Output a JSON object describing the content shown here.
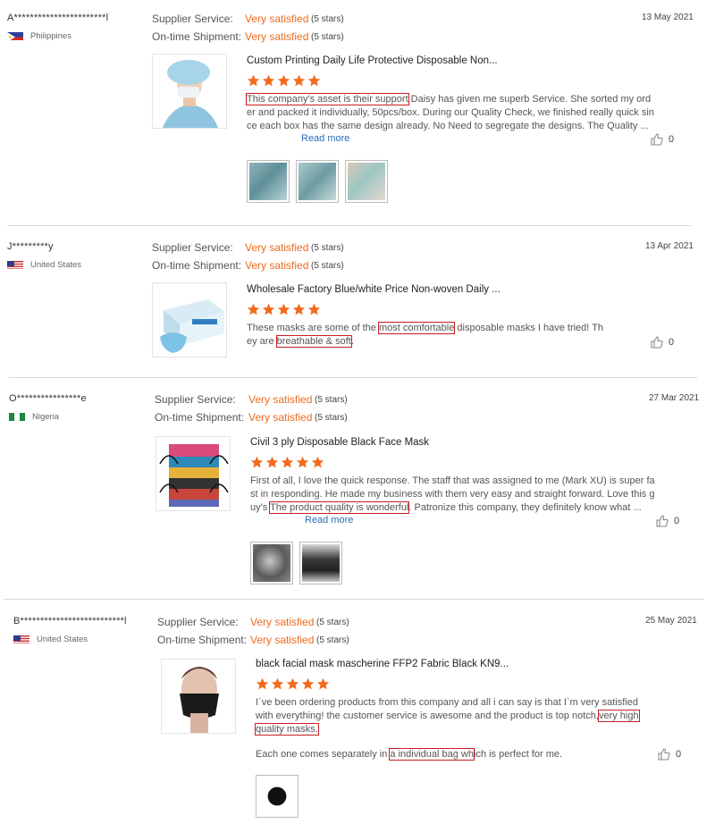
{
  "labels": {
    "supplier_service": "Supplier Service:",
    "ontime_shipment": "On-time Shipment:",
    "read_more": "Read more"
  },
  "reviews": [
    {
      "name": "A***********************l",
      "country": "Philippines",
      "date": "13 May 2021",
      "supplier_service": "Very satisfied",
      "supplier_service_count": "(5 stars)",
      "ontime_shipment": "Very satisfied",
      "ontime_shipment_count": "(5 stars)",
      "product_title": "Custom Printing Daily Life Protective Disposable Non...",
      "rating": 5,
      "text": [
        "This company's asset is their support",
        " Daisy  has given me superb Service. She sorted my order and packed it individually, 50pcs/box. During our Quality Check, we finished really quick since each box has the same design already. No Need to segregate the designs. The Quality ..."
      ],
      "likes": "0"
    },
    {
      "name": "J*********y",
      "country": "United States",
      "date": "13 Apr 2021",
      "supplier_service": "Very satisfied",
      "supplier_service_count": "(5 stars)",
      "ontime_shipment": "Very satisfied",
      "ontime_shipment_count": "(5 stars)",
      "product_title": "Wholesale Factory Blue/white Price Non-woven Daily ...",
      "rating": 5,
      "text": [
        "These masks are some of the ",
        "most comfortable",
        " disposable masks I have tried! They are ",
        "breathable & soft",
        "."
      ],
      "likes": "0"
    },
    {
      "name": "O****************e",
      "country": "Nigeria",
      "date": "27 Mar 2021",
      "supplier_service": "Very satisfied",
      "supplier_service_count": "(5 stars)",
      "ontime_shipment": "Very satisfied",
      "ontime_shipment_count": "(5 stars)",
      "product_title": "Civil 3 ply Disposable Black Face Mask",
      "rating": 5,
      "text": [
        "First of all, I love the quick response. The staff that was assigned to me (Mark XU) is super fast in responding. He made my business with them very easy and straight forward. Love this guy's ",
        "The product quality is wonderful",
        ". Patronize this company, they definitely know what ..."
      ],
      "likes": "0"
    },
    {
      "name": "B**************************l",
      "country": "United States",
      "date": "25 May 2021",
      "supplier_service": "Very satisfied",
      "supplier_service_count": "(5 stars)",
      "ontime_shipment": "Very satisfied",
      "ontime_shipment_count": "(5 stars)",
      "product_title": "black facial mask mascherine FFP2 Fabric Black KN9...",
      "rating": 5,
      "text": [
        "I`ve been ordering products from this company and all i can say is that I`m very satisfied with everything! the customer service is awesome and the product is top notch,",
        "very high quality masks.",
        ""
      ],
      "text2": [
        "Each one comes separately in ",
        "a individual bag wh",
        "ich is perfect for me."
      ],
      "likes": "0"
    }
  ]
}
